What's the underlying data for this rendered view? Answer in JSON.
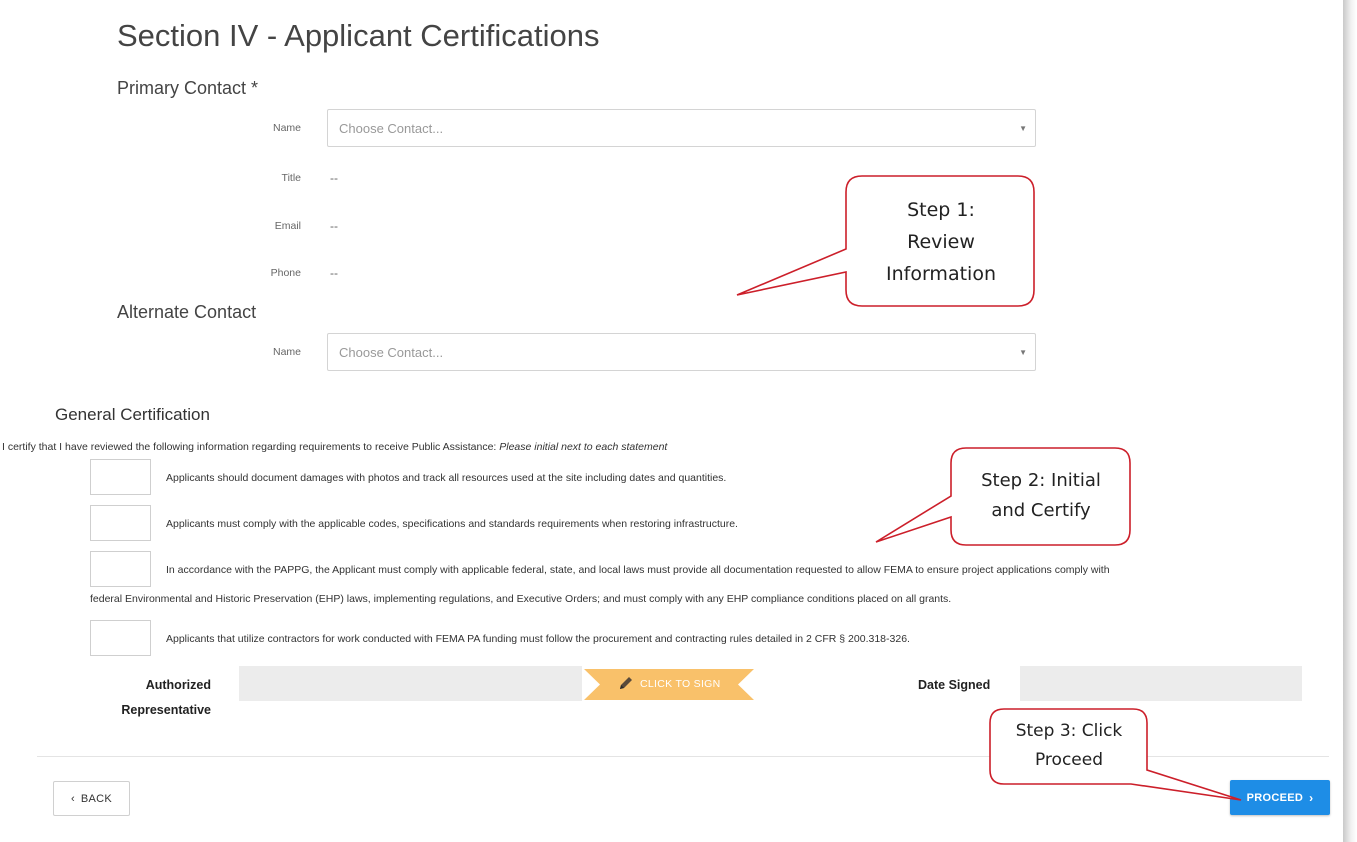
{
  "header": {
    "title": "Section IV - Applicant Certifications"
  },
  "primary_contact": {
    "heading": "Primary Contact *",
    "name_label": "Name",
    "name_placeholder": "Choose Contact...",
    "title_label": "Title",
    "title_value": "--",
    "email_label": "Email",
    "email_value": "--",
    "phone_label": "Phone",
    "phone_value": "--"
  },
  "alternate_contact": {
    "heading": "Alternate Contact",
    "name_label": "Name",
    "name_placeholder": "Choose Contact..."
  },
  "general_certification": {
    "heading": "General Certification",
    "intro": "I certify that I have reviewed the following information regarding requirements to receive Public Assistance: ",
    "intro_emphasis": "Please initial next to each statement",
    "statements": [
      "Applicants should document damages with photos and track all resources used at the site including dates and quantities.",
      "Applicants must comply with the applicable codes, specifications and standards requirements when restoring infrastructure.",
      "In accordance with the PAPPG, the Applicant must comply with applicable federal, state, and local laws must provide all documentation requested to allow FEMA to ensure project applications comply with",
      "federal Environmental and Historic Preservation (EHP) laws, implementing regulations, and Executive Orders; and must comply with any EHP compliance conditions placed on all grants.",
      "Applicants that utilize contractors for work conducted with FEMA PA funding must follow the procurement and contracting rules detailed in 2 CFR § 200.318-326."
    ]
  },
  "signature": {
    "authorized_label_line1": "Authorized",
    "authorized_label_line2": "Representative",
    "click_to_sign": "CLICK TO SIGN",
    "date_signed_label": "Date Signed"
  },
  "navigation": {
    "back_label": "BACK",
    "proceed_label": "PROCEED"
  },
  "callouts": {
    "step1_line1": "Step 1:",
    "step1_line2": "Review",
    "step1_line3": "Information",
    "step2_line1": "Step 2: Initial",
    "step2_line2": "and Certify",
    "step3_line1": "Step 3: Click",
    "step3_line2": "Proceed"
  },
  "colors": {
    "accent_blue": "#1e8de6",
    "sign_orange": "#f9c16a",
    "callout_border": "#cc1f2a",
    "field_gray": "#ececec"
  }
}
